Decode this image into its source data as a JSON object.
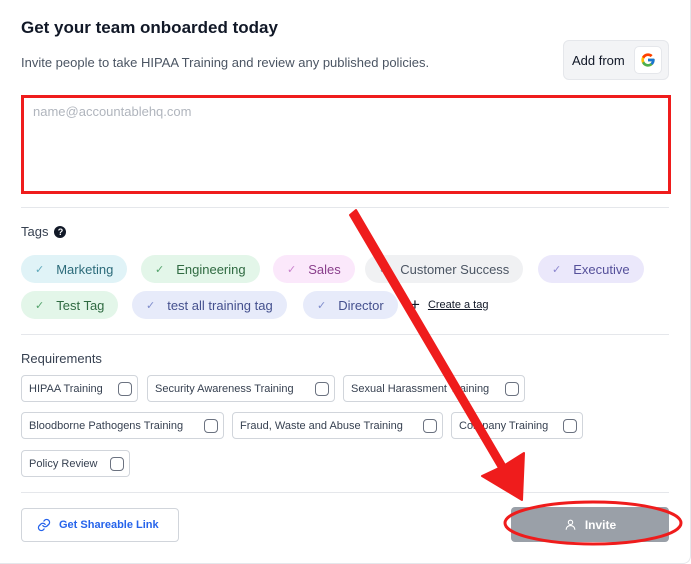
{
  "header": {
    "title": "Get your team onboarded today",
    "subtitle": "Invite people to take HIPAA Training and review any published policies.",
    "add_from_label": "Add from"
  },
  "email_input": {
    "placeholder": "name@accountablehq.com",
    "value": ""
  },
  "tags": {
    "label": "Tags",
    "help_glyph": "?",
    "items": [
      {
        "label": "Marketing",
        "color": "#e3f6e9",
        "selected": true
      },
      {
        "label": "Engineering",
        "color": "#e3f6e9",
        "selected": true
      },
      {
        "label": "Sales",
        "color": "#fbe8fb",
        "selected": true
      },
      {
        "label": "Customer Success",
        "color": "#f0f1f3",
        "selected": true
      },
      {
        "label": "Executive",
        "color": "#ebe8fb",
        "selected": true
      },
      {
        "label": "Test Tag",
        "color": "#e3f6e9",
        "selected": true
      },
      {
        "label": "test all training tag",
        "color": "#e7ebfa",
        "selected": true
      },
      {
        "label": "Director",
        "color": "#e7ebfa",
        "selected": true
      }
    ],
    "create_label": "Create a tag"
  },
  "requirements": {
    "label": "Requirements",
    "items": [
      {
        "label": "HIPAA Training",
        "checked": false
      },
      {
        "label": "Security Awareness Training",
        "checked": false
      },
      {
        "label": "Sexual Harassment Training",
        "checked": false
      },
      {
        "label": "Bloodborne Pathogens Training",
        "checked": false
      },
      {
        "label": "Fraud, Waste and Abuse Training",
        "checked": false
      },
      {
        "label": "Company Training",
        "checked": false
      },
      {
        "label": "Policy Review",
        "checked": false
      }
    ]
  },
  "footer": {
    "share_label": "Get Shareable Link",
    "invite_label": "Invite"
  },
  "icons": {
    "check": "check-icon",
    "google": "google-logo-icon",
    "link": "link-icon",
    "user": "user-icon",
    "plus": "plus-icon"
  },
  "annotation": {
    "highlight_color": "#ef1c1c"
  }
}
